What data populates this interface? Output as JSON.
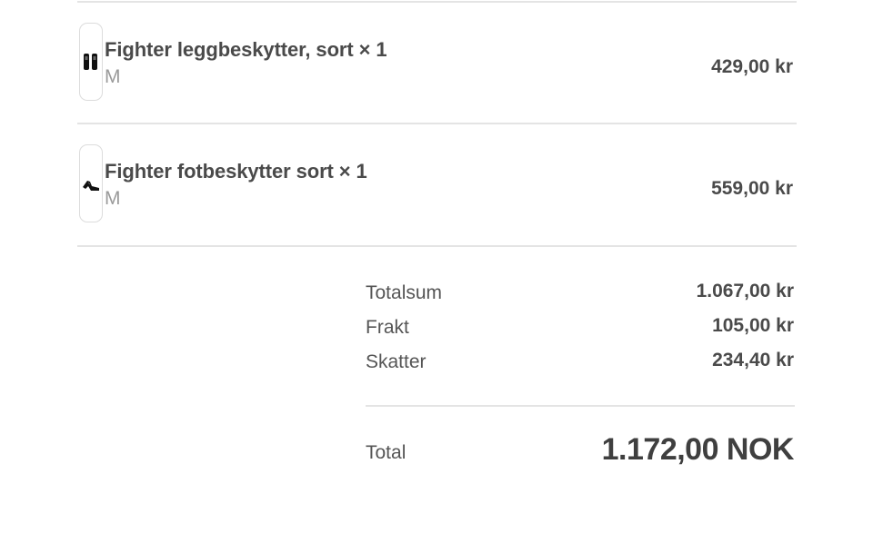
{
  "order": {
    "items": [
      {
        "title": "Fighter leggbeskytter, sort × 1",
        "variant": "M",
        "price": "429,00 kr",
        "thumbnail_icon": "shin-guard-icon"
      },
      {
        "title": "Fighter fotbeskytter sort × 1",
        "variant": "M",
        "price": "559,00 kr",
        "thumbnail_icon": "foot-protector-icon"
      }
    ]
  },
  "summary": {
    "subtotal_label": "Totalsum",
    "subtotal_value": "1.067,00 kr",
    "shipping_label": "Frakt",
    "shipping_value": "105,00 kr",
    "taxes_label": "Skatter",
    "taxes_value": "234,40 kr",
    "total_label": "Total",
    "total_value": "1.172,00 NOK"
  },
  "colors": {
    "text": "#4a4a4a",
    "muted": "#9a9a9a",
    "divider": "#e4e4e4"
  }
}
